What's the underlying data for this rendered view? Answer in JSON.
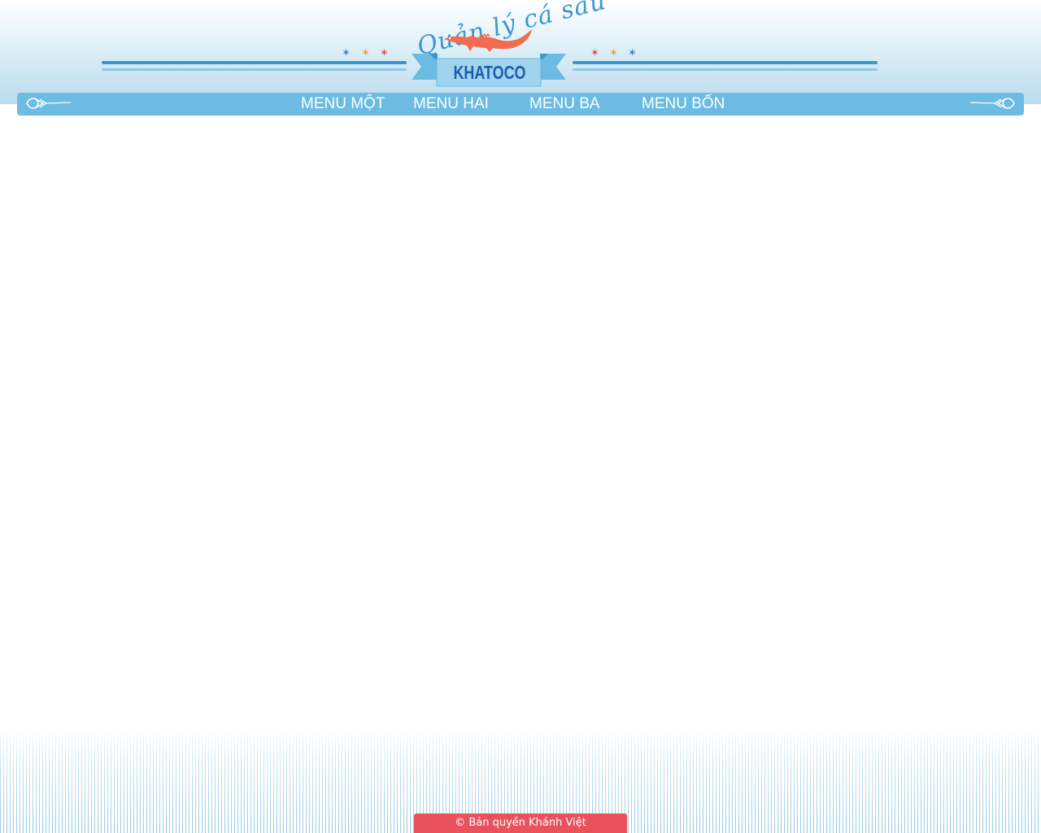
{
  "header": {
    "logo_script": "Quản lý cá sấu",
    "brand": "KHATOCO",
    "stars_left": [
      "red",
      "orange",
      "blue"
    ],
    "stars_right": [
      "red",
      "orange",
      "blue"
    ]
  },
  "nav": {
    "items": [
      {
        "label": "MENU MỘT"
      },
      {
        "label": "MENU HAI"
      },
      {
        "label": "MENU BA"
      },
      {
        "label": "MENU BỐN"
      }
    ]
  },
  "footer": {
    "copyright": "© Bản quyền Khánh Việt"
  },
  "colors": {
    "nav_bar": "#6bbbe2",
    "rule": "#3a97cf",
    "brand_text": "#1d5fae",
    "croc": "#f26c4f",
    "footer_badge": "#e9525b",
    "star_blue": "#2e86c8",
    "star_orange": "#f29b32",
    "star_red": "#ee4a4a"
  }
}
